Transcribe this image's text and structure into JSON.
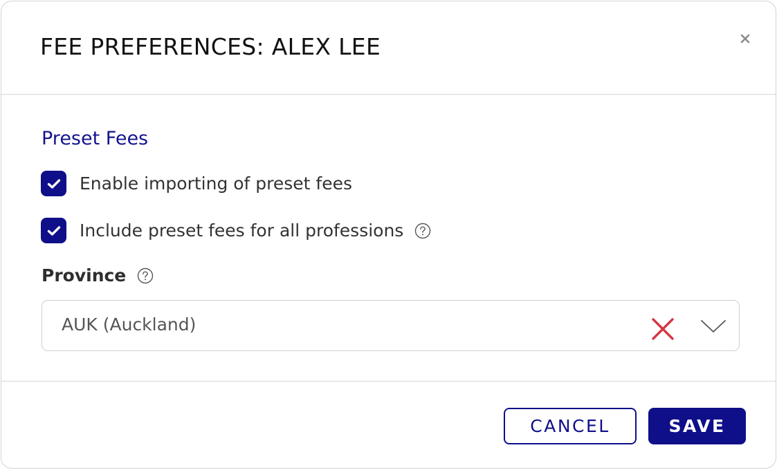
{
  "dialog": {
    "title": "FEE PREFERENCES: ALEX LEE",
    "close_icon": "close-icon"
  },
  "preset_fees": {
    "section_title": "Preset Fees",
    "enable_import": {
      "label": "Enable importing of preset fees",
      "checked": true
    },
    "include_all": {
      "label": "Include preset fees for all professions",
      "checked": true,
      "help_icon": "question-circle-icon"
    }
  },
  "province": {
    "label": "Province",
    "help_icon": "question-circle-icon",
    "selected_value": "AUK (Auckland)",
    "clear_icon": "clear-x-icon",
    "dropdown_icon": "chevron-down-icon"
  },
  "footer": {
    "cancel_label": "CANCEL",
    "save_label": "SAVE"
  },
  "colors": {
    "primary": "#0f0f8a",
    "clear_icon": "#d63545",
    "border": "#d3d3d8"
  }
}
